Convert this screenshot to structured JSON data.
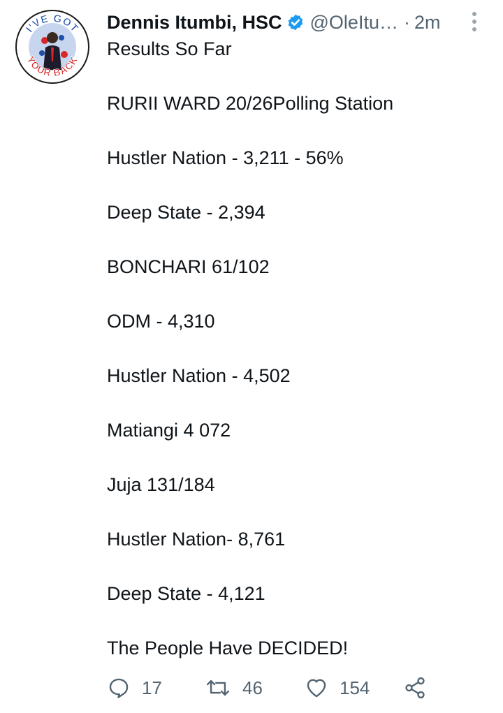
{
  "author": {
    "name": "Dennis Itumbi, HSC",
    "handle": "@OleItu…",
    "separator": "·",
    "time": "2m",
    "avatar_text_top": "I'VE GOT",
    "avatar_text_bottom": "YOUR BACK"
  },
  "tweet": {
    "lines": [
      "Results So Far",
      "RURII WARD 20/26Polling Station",
      "Hustler Nation - 3,211 - 56%",
      "Deep State - 2,394",
      "BONCHARI 61/102",
      "ODM - 4,310",
      "Hustler Nation - 4,502",
      "Matiangi 4 072",
      "Juja 131/184",
      "Hustler Nation- 8,761",
      "Deep State - 4,121",
      "The People Have DECIDED!"
    ]
  },
  "actions": {
    "reply_count": "17",
    "retweet_count": "46",
    "like_count": "154"
  },
  "colors": {
    "text": "#0f1419",
    "muted": "#536471",
    "verified": "#1d9bf0",
    "avatar_red": "#d62828",
    "avatar_blue": "#1f4fa8"
  },
  "icons": {
    "verified": "verified-badge-icon",
    "more": "more-vertical-icon",
    "reply": "reply-icon",
    "retweet": "retweet-icon",
    "like": "heart-icon",
    "share": "share-icon"
  }
}
